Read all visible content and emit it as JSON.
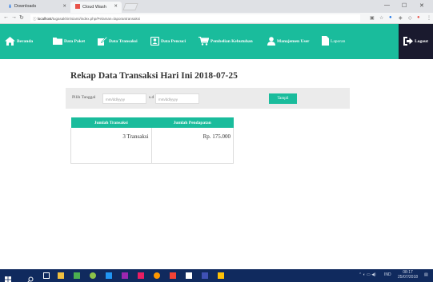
{
  "browser": {
    "tabs": [
      {
        "label": "Downloads",
        "active": false
      },
      {
        "label": "Cloud Wash",
        "active": true
      }
    ],
    "url_host": "localhost",
    "url_path": "/tugasakhirrisiami/index.php/Pelaman=laporantransaksi"
  },
  "nav": {
    "items": [
      {
        "label": "Beranda",
        "icon": "home-icon"
      },
      {
        "label": "Data Paket",
        "icon": "folder-icon"
      },
      {
        "label": "Data Transaksi",
        "icon": "edit-icon"
      },
      {
        "label": "Data Pencuci",
        "icon": "id-card-icon"
      },
      {
        "label": "Pembelian Kebutuhan",
        "icon": "cart-icon"
      },
      {
        "label": "Manajemen User",
        "icon": "user-icon"
      },
      {
        "label": "Laporan",
        "icon": "file-icon"
      }
    ],
    "logout_label": "Logout"
  },
  "main": {
    "title": "Rekap Data Transaksi Hari Ini 2018-07-25",
    "filter": {
      "label": "Pilih Tanggal",
      "date_from_placeholder": "mm/dd/yyyy",
      "separator": "s.d",
      "date_to_placeholder": "mm/dd/yyyy",
      "submit_label": "Tampil"
    },
    "table": {
      "headers": [
        "Jumlah Transaksi",
        "Jumlah Pendapatan"
      ],
      "rows": [
        [
          "3 Transaksi",
          "Rp. 175.000"
        ]
      ]
    }
  },
  "taskbar": {
    "language": "IND",
    "time": "08:17",
    "date": "25/07/2018"
  },
  "colors": {
    "accent": "#1abc9c",
    "logout_bg": "#1a1a2e",
    "taskbar_bg": "#102a5e"
  }
}
